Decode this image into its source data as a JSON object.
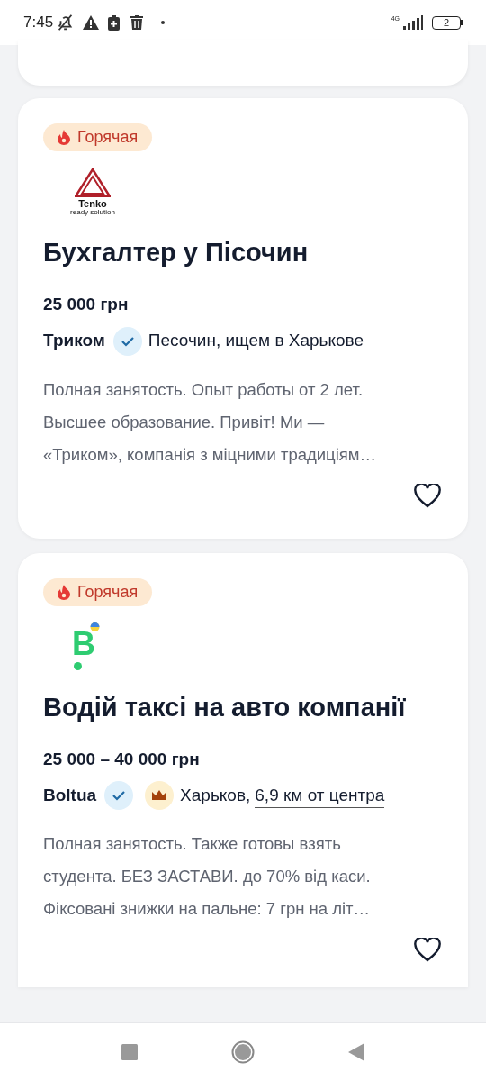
{
  "status_bar": {
    "time": "7:45",
    "network": "4G",
    "battery": "2"
  },
  "jobs": [
    {
      "hot": true,
      "badge": "Горячая",
      "logo": {
        "kind": "tenko",
        "text": "Tenko",
        "subtext": "ready solution"
      },
      "title": "Бухгалтер у Пісочин",
      "salary": "25 000 грн",
      "company": "Триком",
      "verified": true,
      "top": false,
      "location": "Песочин, ищем в Харькове",
      "description_lines": [
        "Полная занятость. Опыт работы от 2 лет.",
        "Высшее образование. Привіт! Ми —",
        "«Триком», компанія з міцними традиціям…"
      ],
      "favorite": false
    },
    {
      "hot": true,
      "badge": "Горячая",
      "logo": {
        "kind": "bolt",
        "text": "B"
      },
      "title": "Водій таксі на авто компанії",
      "salary": "25 000 – 40 000 грн",
      "company": "Boltua",
      "verified": true,
      "top": true,
      "location": "Харьков,",
      "distance": "6,9 км от центра",
      "description_lines": [
        "Полная занятость. Также готовы взять",
        "студента. БЕЗ ЗАСТАВИ. до 70% від каси.",
        "Фіксовані знижки на пальне: 7 грн на літ…"
      ],
      "favorite": false
    }
  ]
}
